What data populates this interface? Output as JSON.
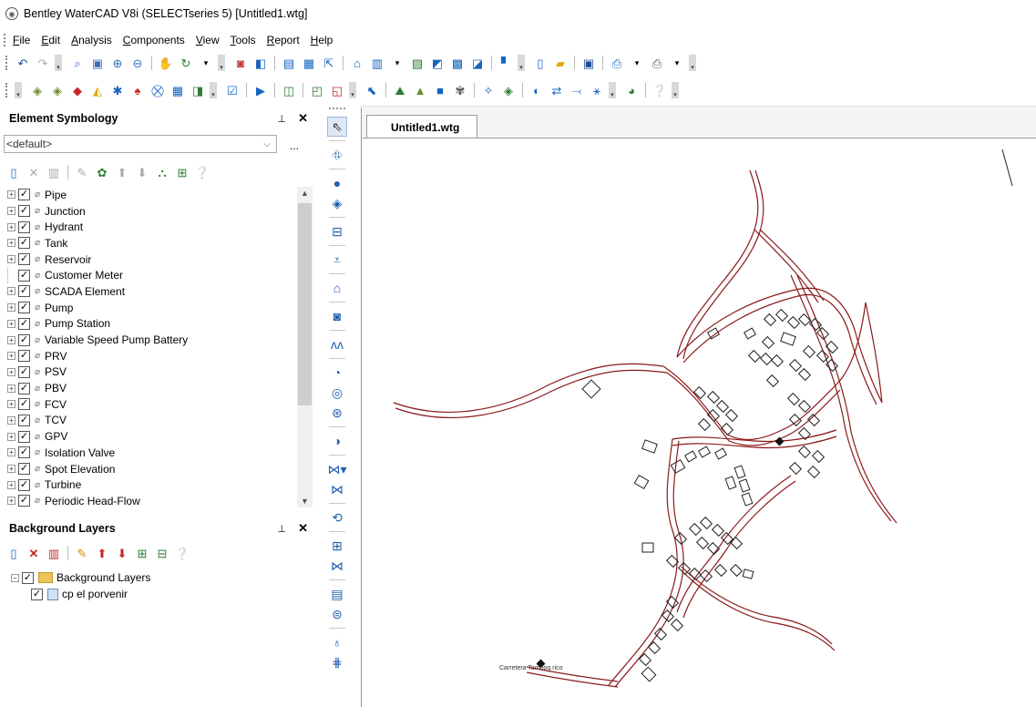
{
  "window": {
    "title": "Bentley WaterCAD V8i (SELECTseries 5) [Untitled1.wtg]"
  },
  "menu": [
    {
      "label": "File",
      "key": "F",
      "rest": "ile"
    },
    {
      "label": "Edit",
      "key": "E",
      "rest": "dit"
    },
    {
      "label": "Analysis",
      "key": "A",
      "rest": "nalysis"
    },
    {
      "label": "Components",
      "key": "C",
      "rest": "omponents"
    },
    {
      "label": "View",
      "key": "V",
      "rest": "iew"
    },
    {
      "label": "Tools",
      "key": "T",
      "rest": "ools"
    },
    {
      "label": "Report",
      "key": "R",
      "rest": "eport"
    },
    {
      "label": "Help",
      "key": "H",
      "rest": "elp"
    }
  ],
  "element_symbology": {
    "title": "Element Symbology",
    "pin": "ꟷ",
    "combo_value": "<default>",
    "combo_more": "...",
    "items": [
      {
        "label": "Pipe",
        "expandable": true
      },
      {
        "label": "Junction",
        "expandable": true
      },
      {
        "label": "Hydrant",
        "expandable": true
      },
      {
        "label": "Tank",
        "expandable": true
      },
      {
        "label": "Reservoir",
        "expandable": true
      },
      {
        "label": "Customer Meter",
        "expandable": false
      },
      {
        "label": "SCADA Element",
        "expandable": true
      },
      {
        "label": "Pump",
        "expandable": true
      },
      {
        "label": "Pump Station",
        "expandable": true
      },
      {
        "label": "Variable Speed Pump Battery",
        "expandable": true
      },
      {
        "label": "PRV",
        "expandable": true
      },
      {
        "label": "PSV",
        "expandable": true
      },
      {
        "label": "PBV",
        "expandable": true
      },
      {
        "label": "FCV",
        "expandable": true
      },
      {
        "label": "TCV",
        "expandable": true
      },
      {
        "label": "GPV",
        "expandable": true
      },
      {
        "label": "Isolation Valve",
        "expandable": true
      },
      {
        "label": "Spot Elevation",
        "expandable": true
      },
      {
        "label": "Turbine",
        "expandable": true
      },
      {
        "label": "Periodic Head-Flow",
        "expandable": true
      }
    ]
  },
  "background_layers": {
    "title": "Background Layers",
    "root_label": "Background Layers",
    "layer_label": "cp el porvenir"
  },
  "document_tab": {
    "label": "Untitled1.wtg"
  },
  "map": {
    "road_label": "Carretera Tambog rico",
    "pipe_color": "#8b1a1a"
  }
}
